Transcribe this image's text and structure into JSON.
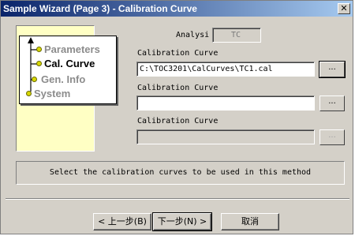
{
  "window": {
    "title": "Sample Wizard (Page 3) - Calibration Curve",
    "close_glyph": "✕"
  },
  "nav": {
    "items": [
      {
        "label": "Parameters",
        "state": "dim"
      },
      {
        "label": "Cal. Curve",
        "state": "active"
      },
      {
        "label": "Gen. Info",
        "state": "dim"
      },
      {
        "label": "System",
        "state": "dim"
      }
    ]
  },
  "analysis": {
    "label": "Analysi",
    "value": "TC"
  },
  "curves": [
    {
      "label": "Calibration Curve",
      "value": "C:\\TOC3201\\CalCurves\\TC1.cal",
      "enabled": true
    },
    {
      "label": "Calibration Curve",
      "value": "",
      "enabled": true
    },
    {
      "label": "Calibration Curve",
      "value": "",
      "enabled": false
    }
  ],
  "browse_label": "...",
  "message": "Select the calibration curves to be used in this method",
  "buttons": {
    "back": "< 上一步(B)",
    "next": "下一步(N) >",
    "cancel": "取消"
  },
  "colors": {
    "titlebar_start": "#0a246a",
    "titlebar_end": "#a6caf0",
    "dialog_bg": "#d4d0c8",
    "nav_panel_bg": "#ffffc4"
  }
}
